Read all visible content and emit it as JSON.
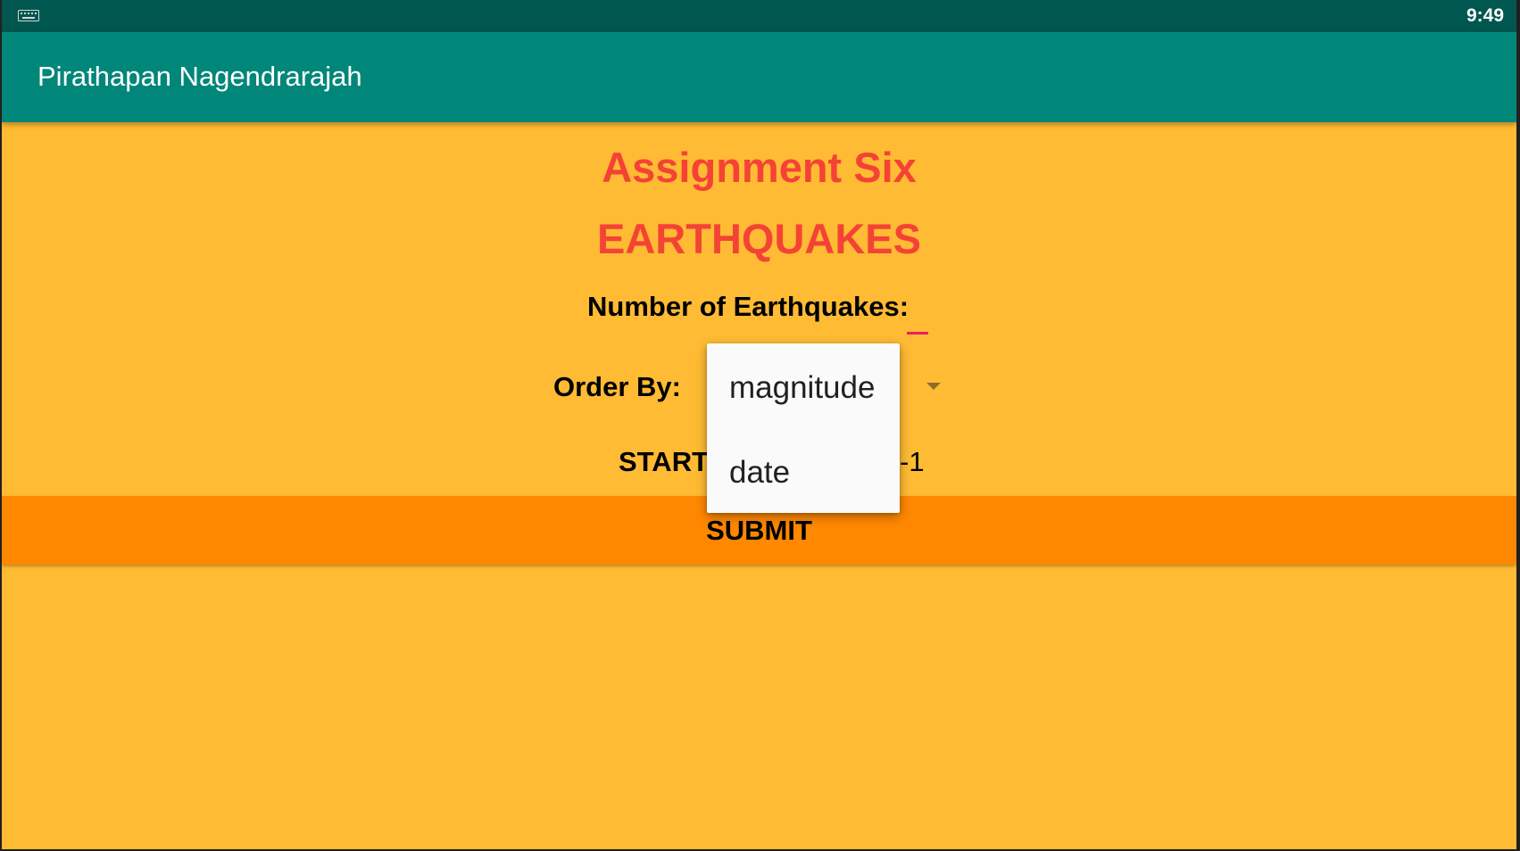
{
  "status_bar": {
    "keyboard_icon": "keyboard-icon",
    "time": "9:49"
  },
  "app_bar": {
    "title": "Pirathapan Nagendrarajah"
  },
  "main": {
    "heading_1": "Assignment Six",
    "heading_2": "EARTHQUAKES",
    "num_label": "Number of Earthquakes:",
    "num_value": "",
    "order_label": "Order By:",
    "order_selected": "magnitude",
    "start_label": "START",
    "start_value_visible": "-1",
    "submit_label": "SUBMIT"
  },
  "dropdown": {
    "options": [
      "magnitude",
      "date"
    ]
  },
  "colors": {
    "status_bar": "#00574F",
    "app_bar": "#00877A",
    "background": "#FFBB33",
    "heading": "#F44336",
    "submit_bg": "#FF8800",
    "input_underline": "#E91E63"
  }
}
